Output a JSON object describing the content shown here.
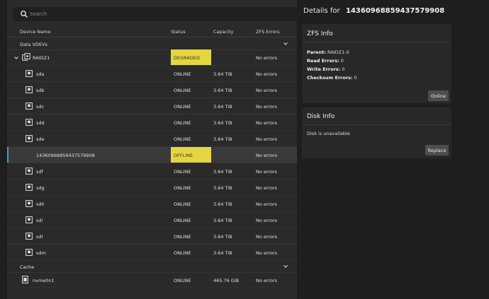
{
  "search": {
    "placeholder": "Search"
  },
  "table": {
    "headers": {
      "device": "Device Name",
      "status": "Status",
      "capacity": "Capacity",
      "errors": "ZFS Errors"
    },
    "groups": [
      {
        "label": "Data VDEVs"
      },
      {
        "label": "Cache"
      }
    ],
    "vdev": {
      "name": "RAIDZ1",
      "status": "DEGRADED",
      "capacity": "",
      "errors": "No errors"
    },
    "rows": [
      {
        "name": "sda",
        "status": "ONLINE",
        "capacity": "3.64 TiB",
        "errors": "No errors"
      },
      {
        "name": "sdb",
        "status": "ONLINE",
        "capacity": "3.64 TiB",
        "errors": "No errors"
      },
      {
        "name": "sdc",
        "status": "ONLINE",
        "capacity": "3.64 TiB",
        "errors": "No errors"
      },
      {
        "name": "sdd",
        "status": "ONLINE",
        "capacity": "3.64 TiB",
        "errors": "No errors"
      },
      {
        "name": "sde",
        "status": "ONLINE",
        "capacity": "3.64 TiB",
        "errors": "No errors"
      },
      {
        "name": "14360968859437579908",
        "status": "OFFLINE",
        "capacity": "",
        "errors": "No errors"
      },
      {
        "name": "sdf",
        "status": "ONLINE",
        "capacity": "3.64 TiB",
        "errors": "No errors"
      },
      {
        "name": "sdg",
        "status": "ONLINE",
        "capacity": "3.64 TiB",
        "errors": "No errors"
      },
      {
        "name": "sdh",
        "status": "ONLINE",
        "capacity": "3.64 TiB",
        "errors": "No errors"
      },
      {
        "name": "sdi",
        "status": "ONLINE",
        "capacity": "3.64 TiB",
        "errors": "No errors"
      },
      {
        "name": "sdl",
        "status": "ONLINE",
        "capacity": "3.64 TiB",
        "errors": "No errors"
      },
      {
        "name": "sdm",
        "status": "ONLINE",
        "capacity": "3.64 TiB",
        "errors": "No errors"
      }
    ],
    "cache_row": {
      "name": "nvme0n1",
      "status": "ONLINE",
      "capacity": "465.76 GiB",
      "errors": "No errors"
    }
  },
  "details": {
    "label": "Details for",
    "device": "14360968859437579908",
    "zfs": {
      "title": "ZFS Info",
      "parent_label": "Parent:",
      "parent_value": "RAIDZ1-0",
      "read_label": "Read Errors:",
      "read_value": "0",
      "write_label": "Write Errors:",
      "write_value": "0",
      "checksum_label": "Checksum Errors:",
      "checksum_value": "0",
      "button": "Online"
    },
    "disk": {
      "title": "Disk Info",
      "message": "Disk is unavailable",
      "button": "Replace"
    }
  },
  "colors": {
    "accent": "#29a6e0",
    "badge": "#e5d540"
  }
}
